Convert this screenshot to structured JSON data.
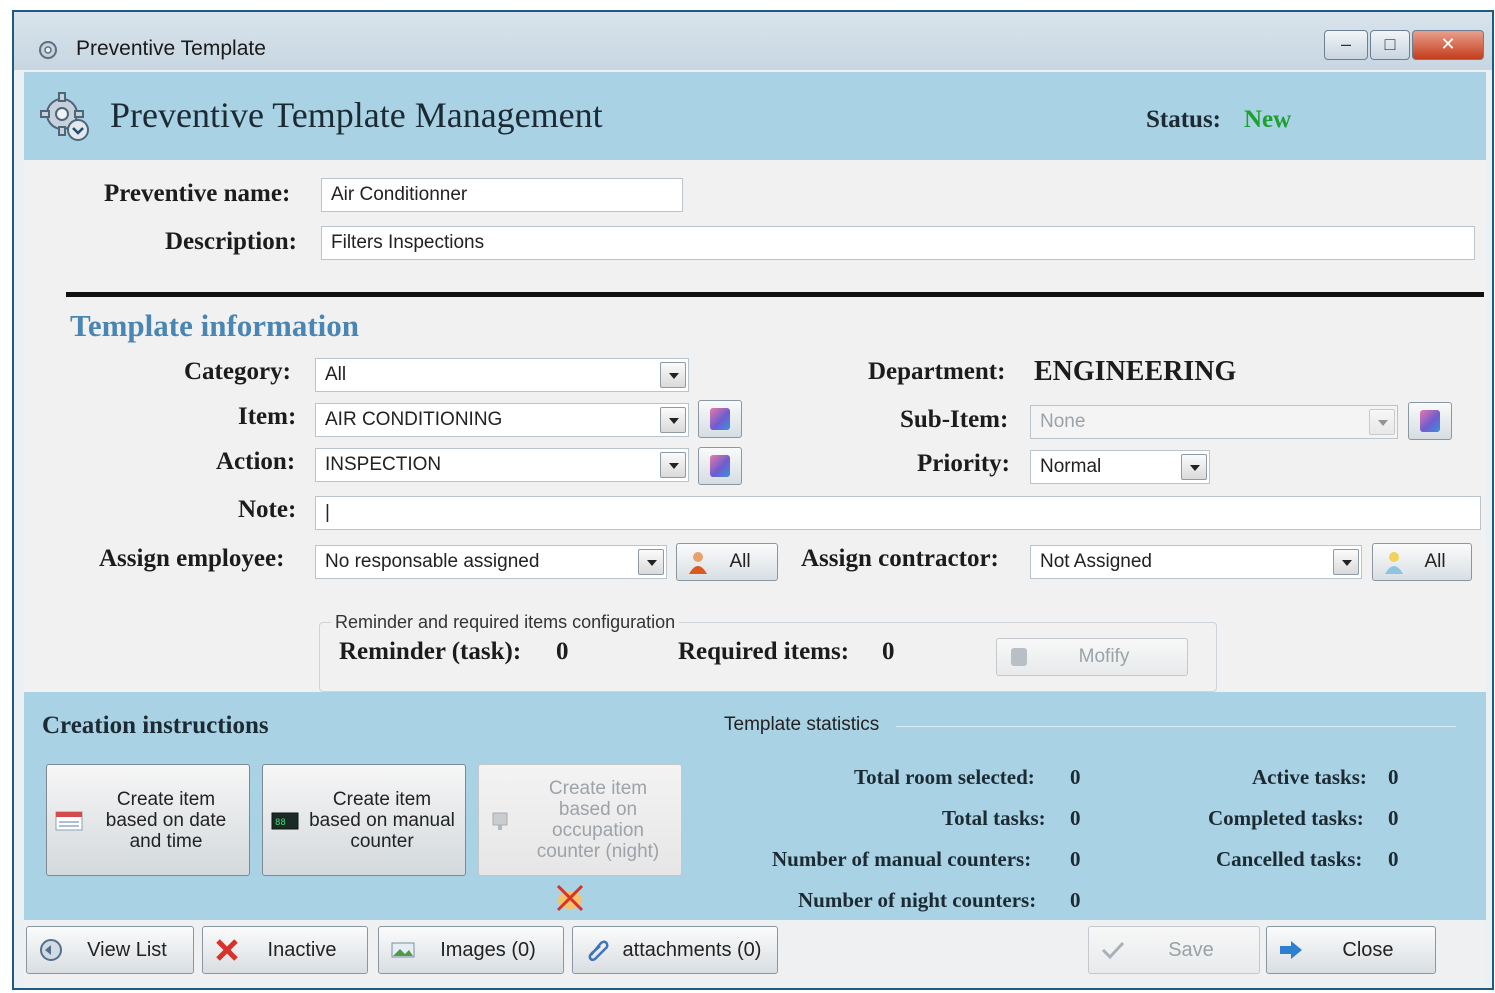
{
  "window": {
    "title": "Preventive Template"
  },
  "header": {
    "title": "Preventive Template Management",
    "status_label": "Status:",
    "status_value": "New",
    "status_color": "#20a030"
  },
  "form": {
    "preventive_name_label": "Preventive name:",
    "preventive_name_value": "Air Conditionner",
    "description_label": "Description:",
    "description_value": "Filters Inspections"
  },
  "template_info": {
    "title": "Template information",
    "category_label": "Category:",
    "category_value": "All",
    "item_label": "Item:",
    "item_value": "AIR CONDITIONING",
    "action_label": "Action:",
    "action_value": "INSPECTION",
    "note_label": "Note:",
    "note_value": "|",
    "department_label": "Department:",
    "department_value": "ENGINEERING",
    "subitem_label": "Sub-Item:",
    "subitem_value": "None",
    "priority_label": "Priority:",
    "priority_value": "Normal",
    "assign_employee_label": "Assign employee:",
    "assign_employee_value": "No responsable assigned",
    "assign_employee_all": "All",
    "assign_contractor_label": "Assign contractor:",
    "assign_contractor_value": "Not Assigned",
    "assign_contractor_all": "All"
  },
  "reminder": {
    "caption": "Reminder and required items configuration",
    "reminder_label": "Reminder (task):",
    "reminder_value": "0",
    "required_label": "Required items:",
    "required_value": "0",
    "modify_label": "Mofify"
  },
  "creation": {
    "title": "Creation instructions",
    "buttons": [
      {
        "label": "Create item based on date and time",
        "enabled": true,
        "icon": "calendar-icon"
      },
      {
        "label": "Create item based on manual counter",
        "enabled": true,
        "icon": "counter-icon"
      },
      {
        "label": "Create item based on occupation counter (night)",
        "enabled": false,
        "icon": "occupation-icon"
      }
    ]
  },
  "statistics": {
    "caption": "Template statistics",
    "total_room_label": "Total room selected:",
    "total_room_value": "0",
    "total_tasks_label": "Total tasks:",
    "total_tasks_value": "0",
    "manual_counters_label": "Number of manual counters:",
    "manual_counters_value": "0",
    "night_counters_label": "Number of night counters:",
    "night_counters_value": "0",
    "active_tasks_label": "Active tasks:",
    "active_tasks_value": "0",
    "completed_tasks_label": "Completed tasks:",
    "completed_tasks_value": "0",
    "cancelled_tasks_label": "Cancelled tasks:",
    "cancelled_tasks_value": "0"
  },
  "footer": {
    "view_list": "View List",
    "inactive": "Inactive",
    "images": "Images (0)",
    "attachments": "attachments (0)",
    "save": "Save",
    "close": "Close"
  }
}
